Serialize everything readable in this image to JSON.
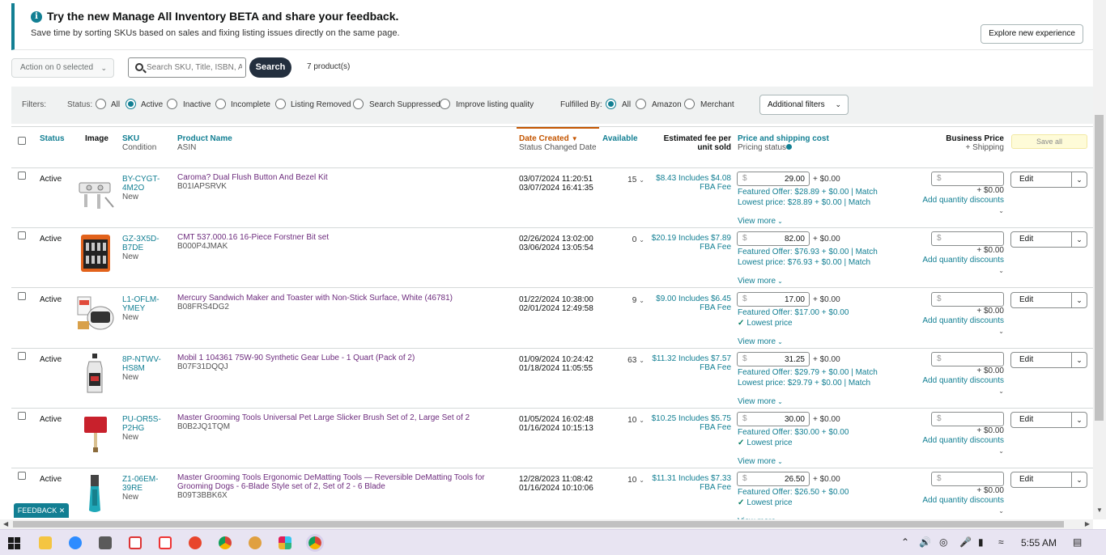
{
  "banner": {
    "title": "Try the new Manage All Inventory BETA and share your feedback.",
    "subtitle": "Save time by sorting SKUs based on sales and fixing listing issues directly on the same page.",
    "button": "Explore new experience"
  },
  "toolbar": {
    "action_label": "Action on 0 selected",
    "search_placeholder": "Search SKU, Title, ISBN, ASIN",
    "search_button": "Search",
    "product_count": "7 product(s)"
  },
  "filters": {
    "label": "Filters:",
    "status_label": "Status:",
    "status_options": [
      "All",
      "Active",
      "Inactive",
      "Incomplete",
      "Listing Removed",
      "Search Suppressed",
      "Improve listing quality"
    ],
    "status_selected": "Active",
    "fulfilled_label": "Fulfilled By:",
    "fulfilled_options": [
      "All",
      "Amazon",
      "Merchant"
    ],
    "fulfilled_selected": "All",
    "additional": "Additional filters"
  },
  "table": {
    "headers": {
      "status": "Status",
      "image": "Image",
      "sku": "SKU",
      "condition": "Condition",
      "product_name": "Product Name",
      "asin": "ASIN",
      "date_created": "Date Created",
      "status_changed": "Status Changed Date",
      "available": "Available",
      "fee_line1": "Estimated fee per",
      "fee_line2": "unit sold",
      "price": "Price and shipping cost",
      "pricing_status": "Pricing status",
      "business_price": "Business Price",
      "business_ship": "+ Shipping",
      "save_all": "Save all"
    },
    "rows": [
      {
        "status": "Active",
        "sku1": "BY-CYGT-",
        "sku2": "4M2O",
        "condition": "New",
        "name": "Caroma? Dual Flush Button And Bezel Kit",
        "asin": "B01IAPSRVK",
        "created": "03/07/2024 11:20:51",
        "changed": "03/07/2024 16:41:35",
        "available": "15",
        "fee1": "$8.43 Includes $4.08",
        "fee2": "FBA Fee",
        "price": "29.00",
        "ship": "+ $0.00",
        "offer1": "Featured Offer: $28.89 + $0.00 | Match",
        "offer2": "Lowest price: $28.89 + $0.00 | Match",
        "view_more": "View more",
        "bp_ship": "+ $0.00",
        "qty": "Add quantity discounts",
        "edit": "Edit",
        "img": "toilet-button"
      },
      {
        "status": "Active",
        "sku1": "GZ-3X5D-",
        "sku2": "B7DE",
        "condition": "New",
        "name": "CMT 537.000.16 16-Piece Forstner Bit set",
        "asin": "B000P4JMAK",
        "created": "02/26/2024 13:02:00",
        "changed": "03/06/2024 13:05:54",
        "available": "0",
        "fee1": "$20.19 Includes $7.89",
        "fee2": "FBA Fee",
        "price": "82.00",
        "ship": "+ $0.00",
        "offer1": "Featured Offer: $76.93 + $0.00 | Match",
        "offer2": "Lowest price: $76.93 + $0.00 | Match",
        "view_more": "View more",
        "bp_ship": "+ $0.00",
        "qty": "Add quantity discounts",
        "edit": "Edit",
        "img": "bit-case"
      },
      {
        "status": "Active",
        "sku1": "L1-OFLM-",
        "sku2": "YMEY",
        "condition": "New",
        "name": "Mercury Sandwich Maker and Toaster with Non-Stick Surface, White (46781)",
        "asin": "B08FRS4DG2",
        "created": "01/22/2024 10:38:00",
        "changed": "02/01/2024 12:49:58",
        "available": "9",
        "fee1": "$9.00 Includes $6.45",
        "fee2": "FBA Fee",
        "price": "17.00",
        "ship": "+ $0.00",
        "offer1": "Featured Offer: $17.00 + $0.00",
        "offer2": "Lowest price",
        "view_more": "View more",
        "bp_ship": "+ $0.00",
        "qty": "Add quantity discounts",
        "edit": "Edit",
        "img": "sandwich-maker"
      },
      {
        "status": "Active",
        "sku1": "8P-NTWV-",
        "sku2": "HS8M",
        "condition": "New",
        "name": "Mobil 1 104361 75W-90 Synthetic Gear Lube - 1 Quart (Pack of 2)",
        "asin": "B07F31DQQJ",
        "created": "01/09/2024 10:24:42",
        "changed": "01/18/2024 11:05:55",
        "available": "63",
        "fee1": "$11.32 Includes $7.57",
        "fee2": "FBA Fee",
        "price": "31.25",
        "ship": "+ $0.00",
        "offer1": "Featured Offer: $29.79 + $0.00 | Match",
        "offer2": "Lowest price: $29.79 + $0.00 | Match",
        "view_more": "View more",
        "bp_ship": "+ $0.00",
        "qty": "Add quantity discounts",
        "edit": "Edit",
        "img": "oil-bottle"
      },
      {
        "status": "Active",
        "sku1": "PU-OR5S-",
        "sku2": "P2HG",
        "condition": "New",
        "name": "Master Grooming Tools Universal Pet Large Slicker Brush Set of 2, Large Set of 2",
        "asin": "B0B2JQ1TQM",
        "created": "01/05/2024 16:02:48",
        "changed": "01/16/2024 10:15:13",
        "available": "10",
        "fee1": "$10.25 Includes $5.75",
        "fee2": "FBA Fee",
        "price": "30.00",
        "ship": "+ $0.00",
        "offer1": "Featured Offer: $30.00 + $0.00",
        "offer2": "Lowest price",
        "view_more": "View more",
        "bp_ship": "+ $0.00",
        "qty": "Add quantity discounts",
        "edit": "Edit",
        "img": "slicker-brush"
      },
      {
        "status": "Active",
        "sku1": "Z1-06EM-",
        "sku2": "39RE",
        "condition": "New",
        "name": "Master Grooming Tools Ergonomic DeMatting Tools — Reversible DeMatting Tools for Grooming Dogs - 6-Blade Style set of 2, Set of 2 - 6 Blade",
        "asin": "B09T3BBK6X",
        "created": "12/28/2023 11:08:42",
        "changed": "01/16/2024 10:10:06",
        "available": "10",
        "fee1": "$11.31 Includes $7.33",
        "fee2": "FBA Fee",
        "price": "26.50",
        "ship": "+ $0.00",
        "offer1": "Featured Offer: $26.50 + $0.00",
        "offer2": "Lowest price",
        "view_more": "View more",
        "bp_ship": "+ $0.00",
        "qty": "Add quantity discounts",
        "edit": "Edit",
        "img": "dematting-tool"
      }
    ]
  },
  "feedback": "FEEDBACK ✕",
  "taskbar": {
    "clock": "5:55 AM"
  },
  "colors": {
    "accent": "#127f93",
    "link_purple": "#6d2b7d",
    "sort_orange": "#c45500",
    "search_btn": "#232f3e"
  }
}
